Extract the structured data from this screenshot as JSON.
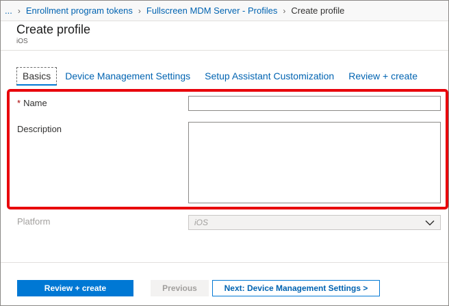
{
  "breadcrumb": {
    "ellipsis": "...",
    "items": [
      "Enrollment program tokens",
      "Fullscreen MDM Server - Profiles"
    ],
    "current": "Create profile",
    "separator": "›"
  },
  "header": {
    "title": "Create profile",
    "subtitle": "iOS"
  },
  "tabs": [
    {
      "label": "Basics",
      "active": true
    },
    {
      "label": "Device Management Settings",
      "active": false
    },
    {
      "label": "Setup Assistant Customization",
      "active": false
    },
    {
      "label": "Review + create",
      "active": false
    }
  ],
  "form": {
    "name": {
      "required_mark": "*",
      "label": "Name",
      "value": ""
    },
    "description": {
      "label": "Description",
      "value": ""
    },
    "platform": {
      "label": "Platform",
      "value": "iOS",
      "disabled": true
    }
  },
  "footer": {
    "review_create_label": "Review + create",
    "previous_label": "Previous",
    "next_label": "Next: Device Management Settings >"
  },
  "colors": {
    "accent": "#0078d4",
    "link": "#0063b1",
    "highlight": "#e8000b"
  },
  "icons": {
    "dropdown": "chevron-down-icon"
  }
}
